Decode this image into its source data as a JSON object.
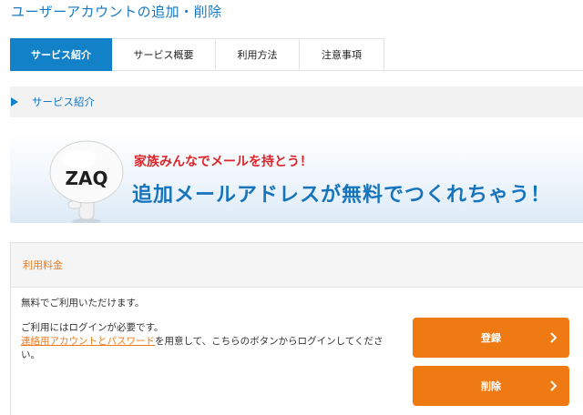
{
  "page": {
    "title": "ユーザーアカウントの追加・削除"
  },
  "tabs": [
    {
      "label": "サービス紹介",
      "active": true
    },
    {
      "label": "サービス概要",
      "active": false
    },
    {
      "label": "利用方法",
      "active": false
    },
    {
      "label": "注意事項",
      "active": false
    }
  ],
  "section": {
    "title": "サービス紹介"
  },
  "banner": {
    "logo_text": "ZAQ",
    "subtitle": "家族みんなでメールを持とう！",
    "headline": "追加メールアドレスが無料でつくれちゃう！"
  },
  "fee": {
    "title": "利用料金",
    "free_text": "無料でご利用いただけます。",
    "login_required": "ご利用にはログインが必要です。",
    "link_text": "連絡用アカウントとパスワード",
    "login_rest": "を用意して、こちらのボタンからログインしてください。",
    "register_label": "登録",
    "delete_label": "削除"
  },
  "colors": {
    "accent_blue": "#1381c7",
    "accent_orange": "#ef7a14",
    "banner_red": "#d9262b"
  },
  "icons": [
    "play-triangle-icon",
    "chevron-right-icon"
  ]
}
